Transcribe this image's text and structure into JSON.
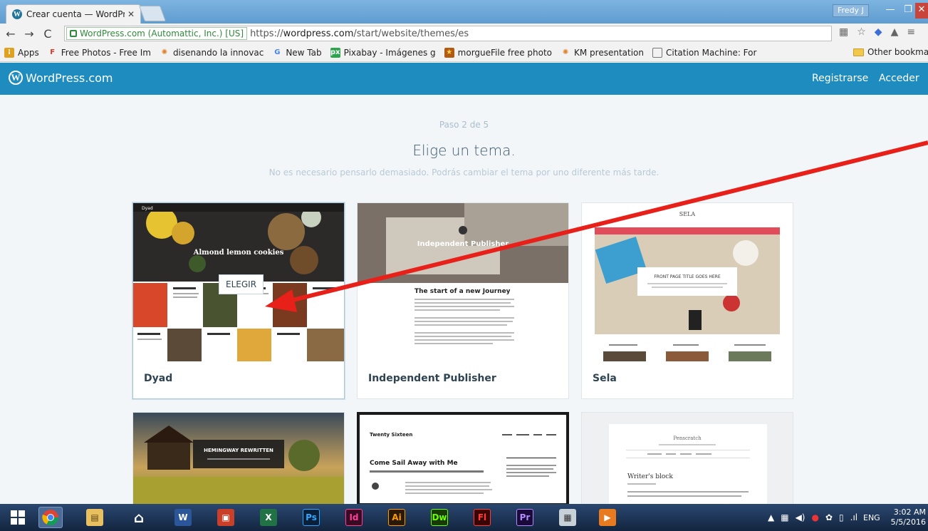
{
  "browser": {
    "tab_title": "Crear cuenta — WordPres",
    "user_badge": "Fredy J",
    "secure_label": "WordPress.com (Automattic, Inc.) [US]",
    "url_prefix": "https://",
    "url_host": "wordpress.com",
    "url_path": "/start/website/themes/es",
    "bookmarks": [
      {
        "label": "Apps",
        "icon": "apps-icon"
      },
      {
        "label": "Free Photos - Free Im",
        "icon": "f-icon"
      },
      {
        "label": "disenando la innovac",
        "icon": "sun-icon"
      },
      {
        "label": "New Tab",
        "icon": "google-icon"
      },
      {
        "label": "Pixabay - Imágenes g",
        "icon": "px-icon"
      },
      {
        "label": "morgueFile free photo",
        "icon": "star-icon"
      },
      {
        "label": "KM presentation",
        "icon": "sun-icon"
      },
      {
        "label": "Citation Machine: For",
        "icon": "page-icon"
      }
    ],
    "other_bookmarks": "Other bookmark"
  },
  "wp": {
    "logo": "WordPress.com",
    "register": "Registrarse",
    "login": "Acceder",
    "step": "Paso 2 de 5",
    "heading": "Elige un tema.",
    "subheading": "No es necesario pensarlo demasiado. Podrás cambiar el tema por uno diferente más tarde.",
    "choose_label": "ELEGIR",
    "themes": [
      {
        "name": "Dyad",
        "preview_title": "Almond lemon cookies"
      },
      {
        "name": "Independent Publisher",
        "preview_title": "Independent Publisher",
        "preview_post": "The start of a new Journey"
      },
      {
        "name": "Sela",
        "preview_title": "SELA",
        "preview_box": "FRONT PAGE TITLE GOES HERE"
      },
      {
        "name": "",
        "preview_title": "HEMINGWAY REWRITTEN"
      },
      {
        "name": "",
        "preview_title": "Twenty Sixteen",
        "preview_post": "Come Sail Away with Me"
      },
      {
        "name": "",
        "preview_title": "Penscratch",
        "preview_post": "Writer's block"
      }
    ]
  },
  "taskbar": {
    "lang": "ENG",
    "time": "3:02 AM",
    "date": "5/5/2016",
    "apps": [
      "start",
      "chrome",
      "explorer",
      "home",
      "word",
      "pdf",
      "excel",
      "Ps",
      "Id",
      "Ai",
      "Dw",
      "Fl",
      "Pr",
      "calc",
      "player"
    ]
  },
  "annotation_color": "#e8201a"
}
